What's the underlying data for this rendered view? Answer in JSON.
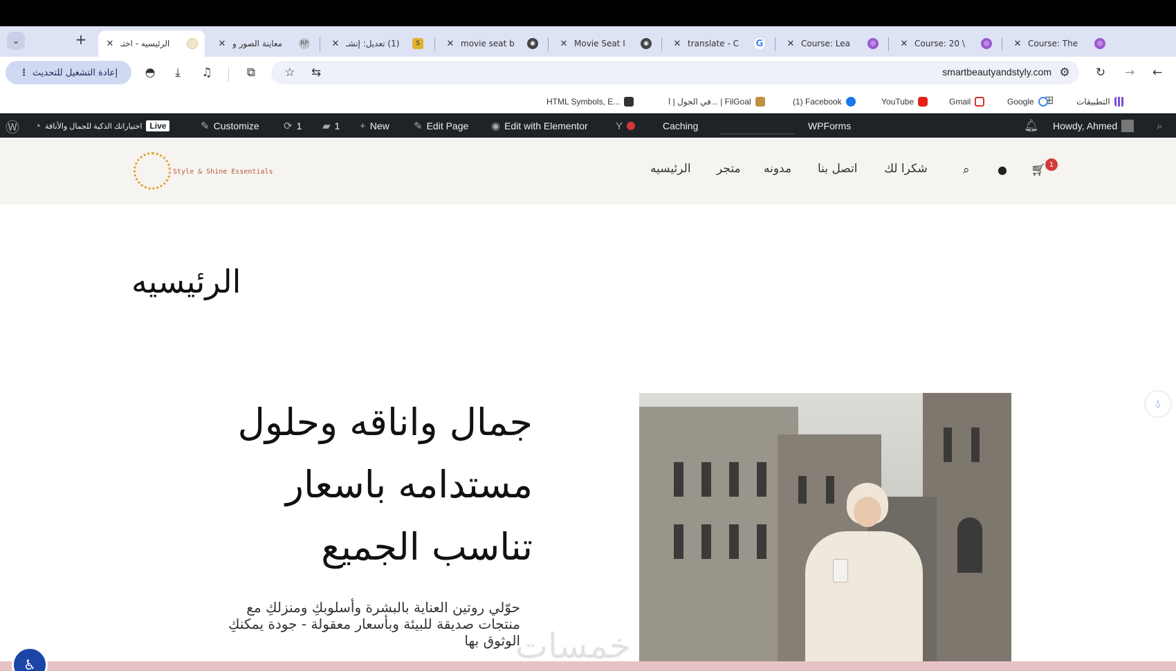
{
  "browser": {
    "tabs": [
      {
        "title": "الرئيسيه - اختـ",
        "favicon_color": "#e8d8b8",
        "favicon_glyph": "",
        "active": true
      },
      {
        "title": "معاينة الصور و",
        "favicon_color": "#c0c4cf",
        "favicon_glyph": "RP",
        "active": false
      },
      {
        "title": "(1) تعديل: إنشـ",
        "favicon_color": "#e0b030",
        "favicon_glyph": "S",
        "active": false
      },
      {
        "title": "movie seat b",
        "favicon_color": "#444444",
        "favicon_glyph": "◉",
        "active": false
      },
      {
        "title": "Movie Seat I",
        "favicon_color": "#444444",
        "favicon_glyph": "◉",
        "active": false
      },
      {
        "title": "translate - C",
        "favicon_color": "#4285f4",
        "favicon_glyph": "G",
        "active": false
      },
      {
        "title": "Course: Lea",
        "favicon_color": "#9b59d0",
        "favicon_glyph": "◎",
        "active": false
      },
      {
        "title": "Course: 20 \\",
        "favicon_color": "#9b59d0",
        "favicon_glyph": "◎",
        "active": false
      },
      {
        "title": "Course: The",
        "favicon_color": "#9b59d0",
        "favicon_glyph": "◎",
        "active": false
      }
    ],
    "new_tab_label": "+",
    "tab_list_label": "⌄",
    "url": "smartbeautyandstyly.com",
    "relaunch_label": "إعادة التشغيل للتحديث",
    "bookmarks": [
      {
        "label": "التطبيقات",
        "icon_color": "#7d4cd9"
      },
      {
        "label": "Google",
        "icon_color": "#4285f4"
      },
      {
        "label": "Gmail",
        "icon_color": "#d93025"
      },
      {
        "label": "YouTube",
        "icon_color": "#e62117"
      },
      {
        "label": "(1) Facebook",
        "icon_color": "#1877f2"
      },
      {
        "label": "في الجول | ا... | FilGoal",
        "icon_color": "#c09040"
      },
      {
        "label": "HTML Symbols, E...",
        "icon_color": "#333333"
      }
    ]
  },
  "adminbar": {
    "site_name": "اختياراتك الذكية للجمال والأناقة",
    "live_badge": "Live",
    "customize": "Customize",
    "updates_count": "1",
    "comments_count": "1",
    "new": "New",
    "edit_page": "Edit Page",
    "edit_elementor": "Edit with Elementor",
    "caching": "Caching",
    "wpforms": "WPForms",
    "howdy": "Howdy, Ahmed"
  },
  "site": {
    "logo_text": "Style & Shine Essentials",
    "menu": [
      "الرئيسيه",
      "متجر",
      "مدونه",
      "اتصل بنا",
      "شكرا لك"
    ],
    "cart_count": "1"
  },
  "page": {
    "title": "الرئيسيه",
    "hero_heading": "جمال واناقه وحلول مستدامه باسعار تناسب الجميع",
    "hero_text": "حوّلي روتين العناية بالبشرة وأسلوبكِ ومنزلكِ مع منتجات صديقة للبيئة وبأسعار معقولة - جودة يمكنكِ الوثوق بها",
    "watermark": "خمسات"
  },
  "colors": {
    "tabstrip": "#dde3f4",
    "adminbar": "#1d2327",
    "header_bg": "#f6f4f1",
    "accent_red": "#d33a3a",
    "logo_gold": "#e3a13a",
    "bottom_bar": "#e7c2c5"
  }
}
